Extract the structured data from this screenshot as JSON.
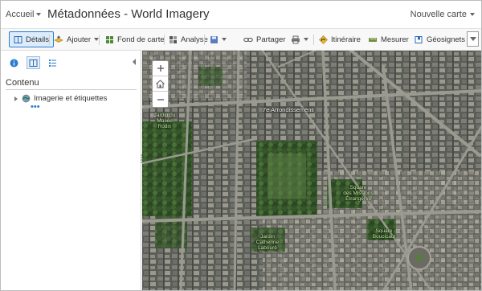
{
  "header": {
    "home_label": "Accueil",
    "title": "Métadonnées - World Imagery",
    "new_map_label": "Nouvelle carte"
  },
  "toolbar": {
    "details_label": "Détails",
    "add_label": "Ajouter",
    "basemap_label": "Fond de carte",
    "analysis_label": "Analyse",
    "share_label": "Partager",
    "directions_label": "Itinéraire",
    "measure_label": "Mesurer",
    "signets_label": "Géosignets"
  },
  "panel": {
    "heading": "Contenu",
    "layers": [
      {
        "label": "Imagerie et étiquettes",
        "more": "•••"
      }
    ]
  },
  "map": {
    "labels": {
      "arrondissement": "7e Arrondissement",
      "rodin": "Jardin du\nMusée\nRodin",
      "missions": "Square\ndes Missions\nÉtrangères",
      "catherine": "Jardin\nCatherine\nLabouré",
      "boucicaut": "Square\nBoucicaut"
    }
  },
  "colors": {
    "accent": "#2b7bd0",
    "active_tab_bg": "#dcecfb",
    "poi_label": "#c9f0a8"
  },
  "icons": {
    "details": "book-icon",
    "add": "add-layer-icon",
    "basemap": "grid-icon",
    "analysis": "analysis-icon",
    "save": "save-icon",
    "share": "share-link-icon",
    "print": "print-icon",
    "directions": "directions-icon",
    "measure": "ruler-icon",
    "signets": "bookmark-icon"
  }
}
